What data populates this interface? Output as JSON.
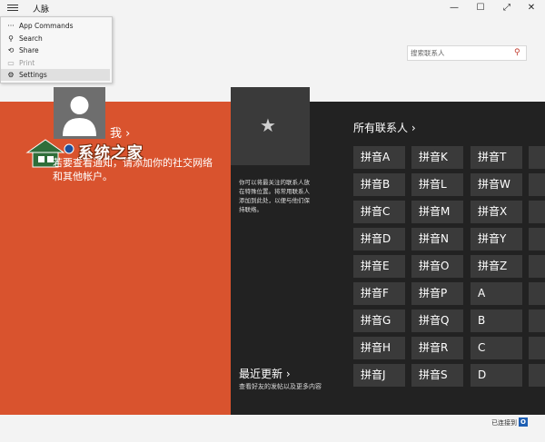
{
  "app": {
    "title": "人脉"
  },
  "menu": [
    {
      "icon": "more-icon",
      "glyph": "···",
      "label": "App Commands"
    },
    {
      "icon": "search-icon",
      "glyph": "⚲",
      "label": "Search"
    },
    {
      "icon": "share-icon",
      "glyph": "⟲",
      "label": "Share"
    },
    {
      "icon": "print-icon",
      "glyph": "▭",
      "label": "Print",
      "disabled": true
    },
    {
      "icon": "gear-icon",
      "glyph": "⚙",
      "label": "Settings",
      "selected": true
    }
  ],
  "search": {
    "placeholder": "搜索联系人"
  },
  "me": {
    "label": "我 ›",
    "promo": "若要查看通知，请添加你的社交网络和其他帐户。"
  },
  "watermark": {
    "text": "系统之家"
  },
  "favorites": {
    "desc": "你可以将最关注的联系人放在特殊位置。将常用联系人添加到此处，以便与他们保持联络。"
  },
  "recent": {
    "title": "最近更新 ›",
    "sub": "查看好友的发帖以及更多内容"
  },
  "all_contacts": {
    "title": "所有联系人 ›",
    "columns": [
      [
        "拼音A",
        "拼音B",
        "拼音C",
        "拼音D",
        "拼音E",
        "拼音F",
        "拼音G",
        "拼音H",
        "拼音J"
      ],
      [
        "拼音K",
        "拼音L",
        "拼音M",
        "拼音N",
        "拼音O",
        "拼音P",
        "拼音Q",
        "拼音R",
        "拼音S"
      ],
      [
        "拼音T",
        "拼音W",
        "拼音X",
        "拼音Y",
        "拼音Z",
        "A",
        "B",
        "C",
        "D"
      ]
    ]
  },
  "status": {
    "connected": "已连接到"
  }
}
